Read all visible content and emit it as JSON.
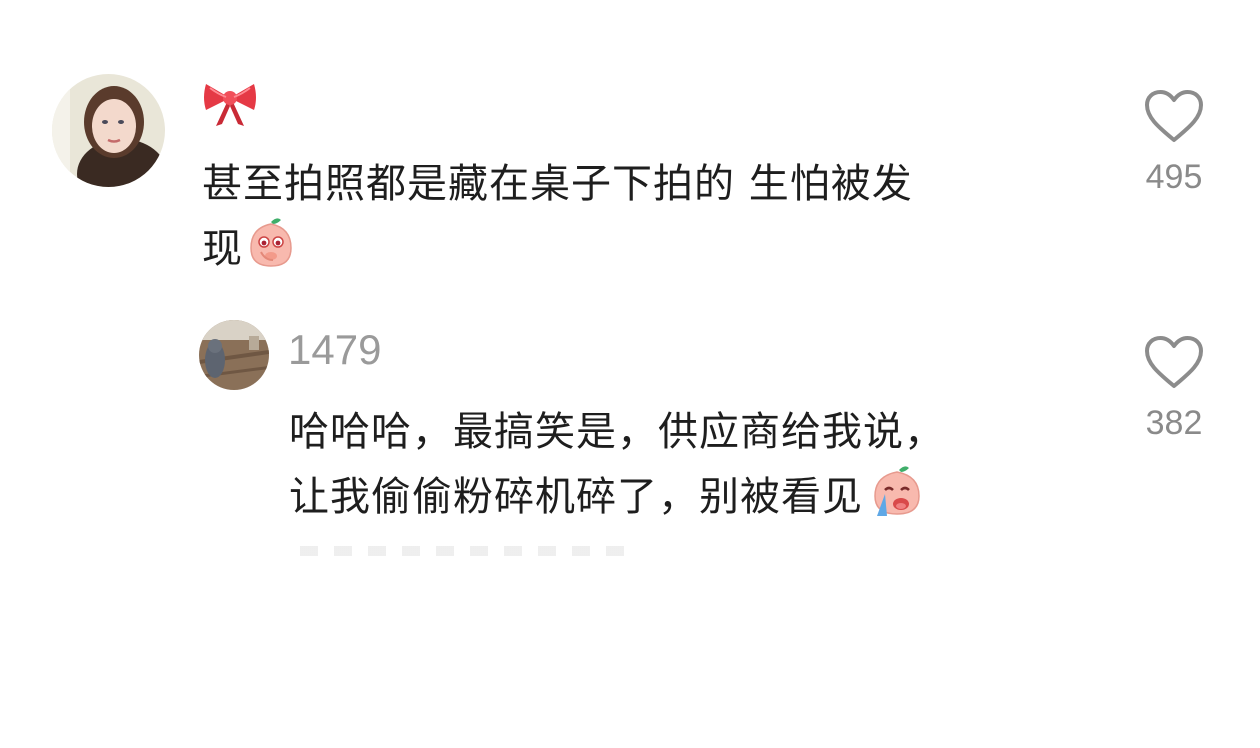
{
  "comments": [
    {
      "username": "🎀",
      "text_line1": "甚至拍照都是藏在桌子下拍的 生怕被发",
      "text_line2": "现",
      "likes": "495",
      "emoji_icon": "peach-shy-emoji-icon"
    },
    {
      "username": "1479",
      "text_line1": "哈哈哈，最搞笑是，供应商给我说，",
      "text_line2": "让我偷偷粉碎机碎了，别被看见",
      "likes": "382",
      "emoji_icon": "peach-crying-emoji-icon"
    }
  ],
  "colors": {
    "username_gray": "#9a9a9a",
    "count_gray": "#8a8a8a",
    "heart_stroke": "#8c8c8c",
    "peach_pink": "#f4a99c"
  }
}
